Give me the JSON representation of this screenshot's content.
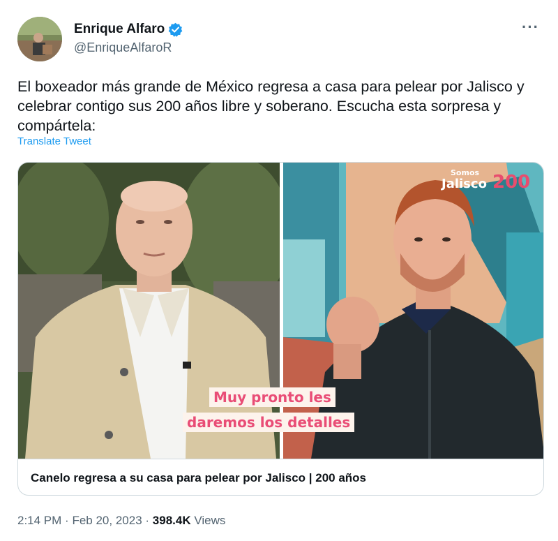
{
  "author": {
    "display_name": "Enrique Alfaro",
    "handle": "@EnriqueAlfaroR",
    "verified_color": "#1d9bf0"
  },
  "more_icon": "more-options-icon",
  "tweet": {
    "text": "El boxeador más grande de México regresa a casa para pelear por Jalisco y celebrar contigo sus 200 años libre y soberano. Escucha esta sorpresa y compártela:",
    "translate_label": "Translate Tweet"
  },
  "media": {
    "overlay_line1": "Muy pronto les",
    "overlay_line2": "daremos los detalles",
    "logo_top": "Somos",
    "logo_main": "Jalisco",
    "logo_number": "200"
  },
  "card": {
    "title": "Canelo regresa a su casa para pelear por Jalisco | 200 años"
  },
  "meta": {
    "time": "2:14 PM",
    "separator": "·",
    "date": "Feb 20, 2023",
    "views_count": "398.4K",
    "views_label": "Views"
  }
}
